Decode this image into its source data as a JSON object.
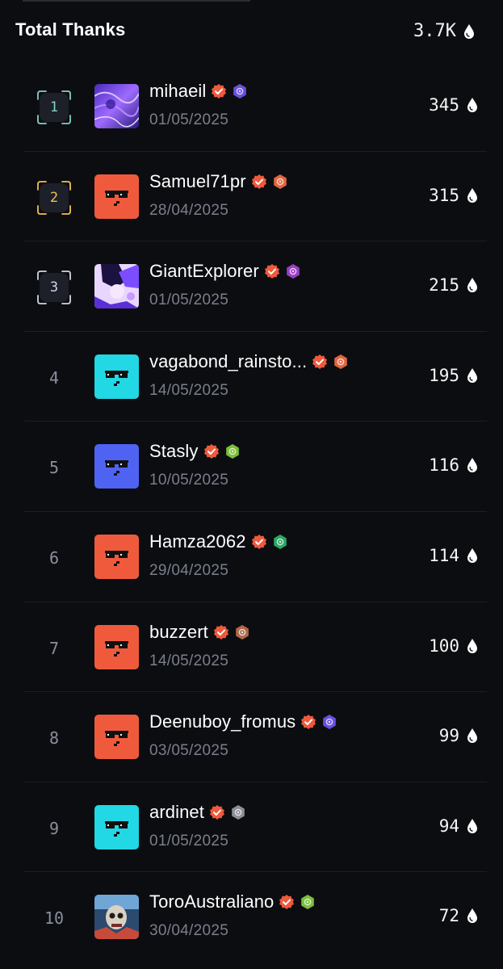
{
  "header": {
    "title": "Total Thanks",
    "total": "3.7K",
    "icon": "drop-icon"
  },
  "colors": {
    "background": "#0c0d11",
    "verified": "#ee5a3c",
    "rank1_frame": "#7fd3c7",
    "rank2_frame": "#f2c14e",
    "rank3_frame": "#cfd6e4"
  },
  "leaderboard": [
    {
      "rank": "1",
      "username": "mihaeil",
      "date": "01/05/2025",
      "score": "345",
      "avatar": "purple-art",
      "badge_color": "#6b4fe0"
    },
    {
      "rank": "2",
      "username": "Samuel71pr",
      "date": "28/04/2025",
      "score": "315",
      "avatar": "orange-sunglasses",
      "badge_color": "#e2663f"
    },
    {
      "rank": "3",
      "username": "GiantExplorer",
      "date": "01/05/2025",
      "score": "215",
      "avatar": "anime-art",
      "badge_color": "#9b3fc4"
    },
    {
      "rank": "4",
      "username": "vagabond_rainsto...",
      "date": "14/05/2025",
      "score": "195",
      "avatar": "cyan-sunglasses",
      "badge_color": "#e2663f"
    },
    {
      "rank": "5",
      "username": "Stasly",
      "date": "10/05/2025",
      "score": "116",
      "avatar": "blue-sunglasses",
      "badge_color": "#7cbf3a"
    },
    {
      "rank": "6",
      "username": "Hamza2062",
      "date": "29/04/2025",
      "score": "114",
      "avatar": "orange-sunglasses",
      "badge_color": "#2aa864"
    },
    {
      "rank": "7",
      "username": "buzzert",
      "date": "14/05/2025",
      "score": "100",
      "avatar": "orange-sunglasses",
      "badge_color": "#b0684a"
    },
    {
      "rank": "8",
      "username": "Deenuboy_fromus",
      "date": "03/05/2025",
      "score": "99",
      "avatar": "orange-sunglasses",
      "badge_color": "#6b4fe0"
    },
    {
      "rank": "9",
      "username": "ardinet",
      "date": "01/05/2025",
      "score": "94",
      "avatar": "cyan-sunglasses",
      "badge_color": "#8d8f96"
    },
    {
      "rank": "10",
      "username": "ToroAustraliano",
      "date": "30/04/2025",
      "score": "72",
      "avatar": "skull-art",
      "badge_color": "#7cbf3a"
    }
  ]
}
